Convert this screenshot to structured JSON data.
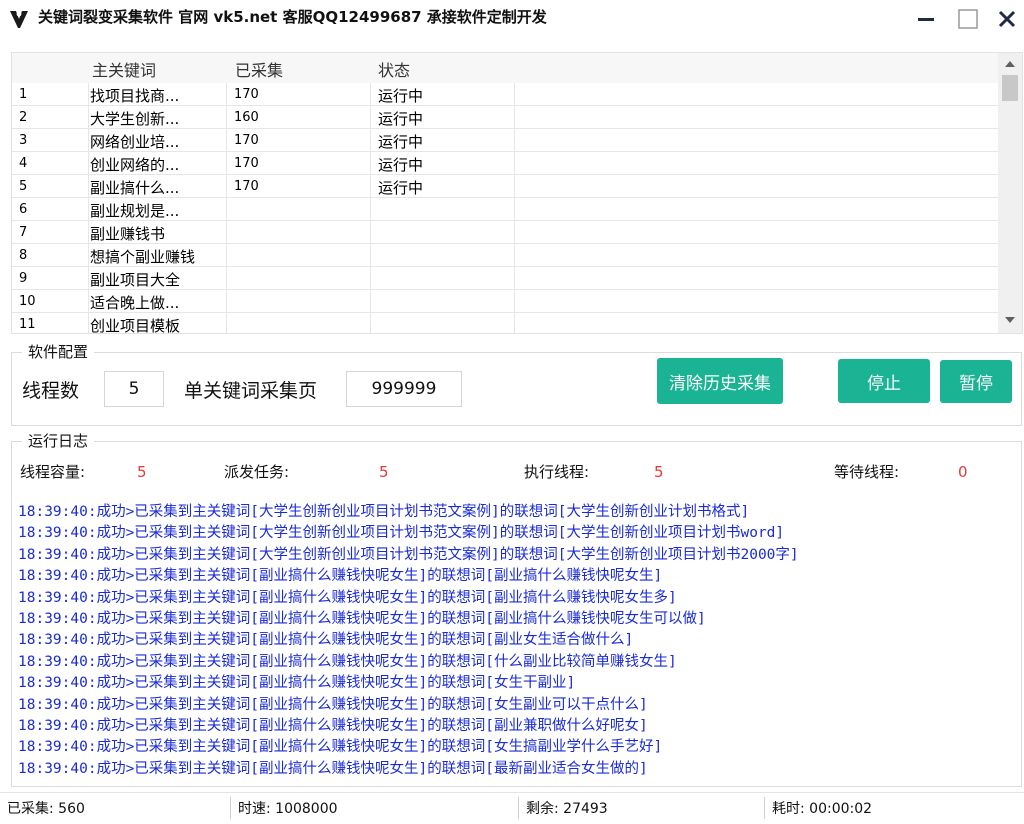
{
  "window": {
    "title": "关键词裂变采集软件 官网 vk5.net 客服QQ12499687 承接软件定制开发"
  },
  "grid": {
    "headers": {
      "num": "",
      "keyword": "主关键词",
      "count": "已采集",
      "status": "状态"
    },
    "rows": [
      {
        "num": "1",
        "keyword": "找项目找商...",
        "count": "170",
        "status": "运行中"
      },
      {
        "num": "2",
        "keyword": "大学生创新...",
        "count": "160",
        "status": "运行中"
      },
      {
        "num": "3",
        "keyword": "网络创业培...",
        "count": "170",
        "status": "运行中"
      },
      {
        "num": "4",
        "keyword": "创业网络的...",
        "count": "170",
        "status": "运行中"
      },
      {
        "num": "5",
        "keyword": "副业搞什么...",
        "count": "170",
        "status": "运行中"
      },
      {
        "num": "6",
        "keyword": "副业规划是...",
        "count": "",
        "status": ""
      },
      {
        "num": "7",
        "keyword": "副业赚钱书",
        "count": "",
        "status": ""
      },
      {
        "num": "8",
        "keyword": "想搞个副业赚钱",
        "count": "",
        "status": ""
      },
      {
        "num": "9",
        "keyword": "副业项目大全",
        "count": "",
        "status": ""
      },
      {
        "num": "10",
        "keyword": "适合晚上做...",
        "count": "",
        "status": ""
      },
      {
        "num": "11",
        "keyword": "创业项目模板",
        "count": "",
        "status": ""
      }
    ]
  },
  "config": {
    "legend": "软件配置",
    "threads_label": "线程数",
    "threads_value": "5",
    "pages_label": "单关键词采集页",
    "pages_value": "999999",
    "clear_button": "清除历史采集",
    "stop_button": "停止",
    "pause_button": "暂停"
  },
  "log": {
    "legend": "运行日志",
    "capacity_label": "线程容量:",
    "capacity_value": "5",
    "dispatched_label": "派发任务:",
    "dispatched_value": "5",
    "running_label": "执行线程:",
    "running_value": "5",
    "waiting_label": "等待线程:",
    "waiting_value": "0",
    "lines": [
      "18:39:40:成功>已采集到主关键词[大学生创新创业项目计划书范文案例]的联想词[大学生创新创业计划书格式]",
      "18:39:40:成功>已采集到主关键词[大学生创新创业项目计划书范文案例]的联想词[大学生创新创业项目计划书word]",
      "18:39:40:成功>已采集到主关键词[大学生创新创业项目计划书范文案例]的联想词[大学生创新创业项目计划书2000字]",
      "18:39:40:成功>已采集到主关键词[副业搞什么赚钱快呢女生]的联想词[副业搞什么赚钱快呢女生]",
      "18:39:40:成功>已采集到主关键词[副业搞什么赚钱快呢女生]的联想词[副业搞什么赚钱快呢女生多]",
      "18:39:40:成功>已采集到主关键词[副业搞什么赚钱快呢女生]的联想词[副业搞什么赚钱快呢女生可以做]",
      "18:39:40:成功>已采集到主关键词[副业搞什么赚钱快呢女生]的联想词[副业女生适合做什么]",
      "18:39:40:成功>已采集到主关键词[副业搞什么赚钱快呢女生]的联想词[什么副业比较简单赚钱女生]",
      "18:39:40:成功>已采集到主关键词[副业搞什么赚钱快呢女生]的联想词[女生干副业]",
      "18:39:40:成功>已采集到主关键词[副业搞什么赚钱快呢女生]的联想词[女生副业可以干点什么]",
      "18:39:40:成功>已采集到主关键词[副业搞什么赚钱快呢女生]的联想词[副业兼职做什么好呢女]",
      "18:39:40:成功>已采集到主关键词[副业搞什么赚钱快呢女生]的联想词[女生搞副业学什么手艺好]",
      "18:39:40:成功>已采集到主关键词[副业搞什么赚钱快呢女生]的联想词[最新副业适合女生做的]"
    ]
  },
  "statusbar": {
    "collected": "已采集: 560",
    "speed": "时速: 1008000",
    "remaining": "剩余: 27493",
    "elapsed": "耗时: 00:00:02"
  },
  "colors": {
    "accent": "#1ab394",
    "log_text": "#1a2bd6",
    "stat_value": "#e23a3a"
  }
}
